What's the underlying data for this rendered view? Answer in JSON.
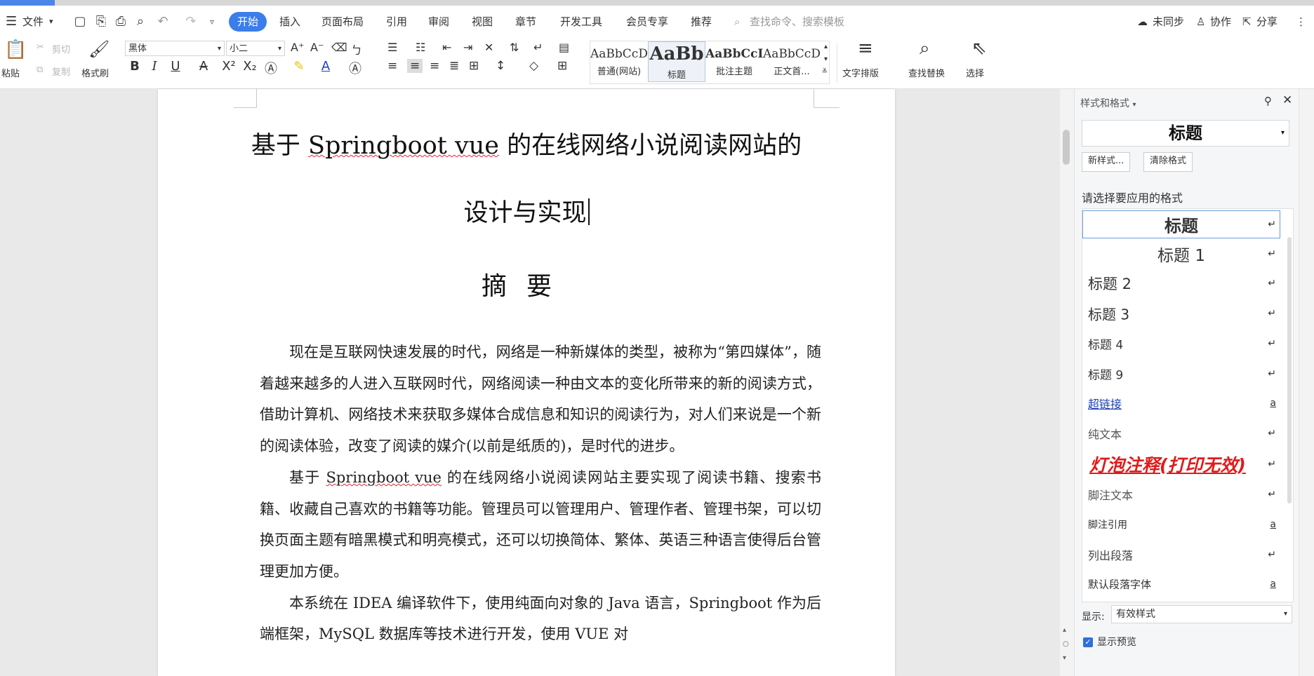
{
  "menu": {
    "file": "文件",
    "tabs": [
      "开始",
      "插入",
      "页面布局",
      "引用",
      "审阅",
      "视图",
      "章节",
      "开发工具",
      "会员专享",
      "推荐"
    ],
    "search_placeholder": "查找命令、搜索模板",
    "sync": "未同步",
    "collab": "协作",
    "share": "分享"
  },
  "ribbon": {
    "paste": "粘贴",
    "cut": "剪切",
    "copy": "复制",
    "format_painter": "格式刷",
    "font_name": "黑体",
    "font_size": "小二",
    "styles": [
      {
        "preview": "AaBbCcDd",
        "name": "普通(网站)"
      },
      {
        "preview": "AaBb",
        "name": "标题"
      },
      {
        "preview": "AaBbCcI",
        "name": "批注主题"
      },
      {
        "preview": "AaBbCcD",
        "name": "正文首..."
      }
    ],
    "text_layout": "文字排版",
    "find_replace": "查找替换",
    "select": "选择"
  },
  "document": {
    "title_line1": "基于 Springboot vue 的在线网络小说阅读网站的",
    "title_line2": "设计与实现",
    "abstract_heading": "摘要",
    "p1": "现在是互联网快速发展的时代，网络是一种新媒体的类型，被称为“第四媒体”，随着越来越多的人进入互联网时代，网络阅读一种由文本的变化所带来的新的阅读方式，借助计算机、网络技术来获取多媒体合成信息和知识的阅读行为，对人们来说是一个新的阅读体验，改变了阅读的媒介(以前是纸质的)，是时代的进步。",
    "p2_prefix": "基于 ",
    "p2_sq": "Springboot vue",
    "p2_rest": " 的在线网络小说阅读网站主要实现了阅读书籍、搜索书籍、收藏自己喜欢的书籍等功能。管理员可以管理用户、管理作者、管理书架，可以切换页面主题有暗黑模式和明亮模式，还可以切换简体、繁体、英语三种语言使得后台管理更加方便。",
    "p3": "本系统在 IDEA 编译软件下，使用纯面向对象的 Java 语言，Springboot 作为后端框架，MySQL 数据库等技术进行开发，使用 VUE 对"
  },
  "panel": {
    "title": "样式和格式",
    "current_style": "标题",
    "new_style": "新样式...",
    "clear_format": "清除格式",
    "hint": "请选择要应用的格式",
    "styles": [
      {
        "name": "标题",
        "mark": "↵"
      },
      {
        "name": "标题 1",
        "mark": "↵"
      },
      {
        "name": "标题 2",
        "mark": "↵"
      },
      {
        "name": "标题 3",
        "mark": "↵"
      },
      {
        "name": "标题 4",
        "mark": "↵"
      },
      {
        "name": "标题 9",
        "mark": "↵"
      },
      {
        "name": "超链接",
        "mark": "a"
      },
      {
        "name": "纯文本",
        "mark": "↵"
      },
      {
        "name": "灯泡注释(打印无效)",
        "mark": "↵"
      },
      {
        "name": "脚注文本",
        "mark": "↵"
      },
      {
        "name": "脚注引用",
        "mark": "a"
      },
      {
        "name": "列出段落",
        "mark": "↵"
      },
      {
        "name": "默认段落字体",
        "mark": "a"
      }
    ],
    "show_label": "显示:",
    "show_value": "有效样式",
    "preview_label": "显示预览"
  }
}
